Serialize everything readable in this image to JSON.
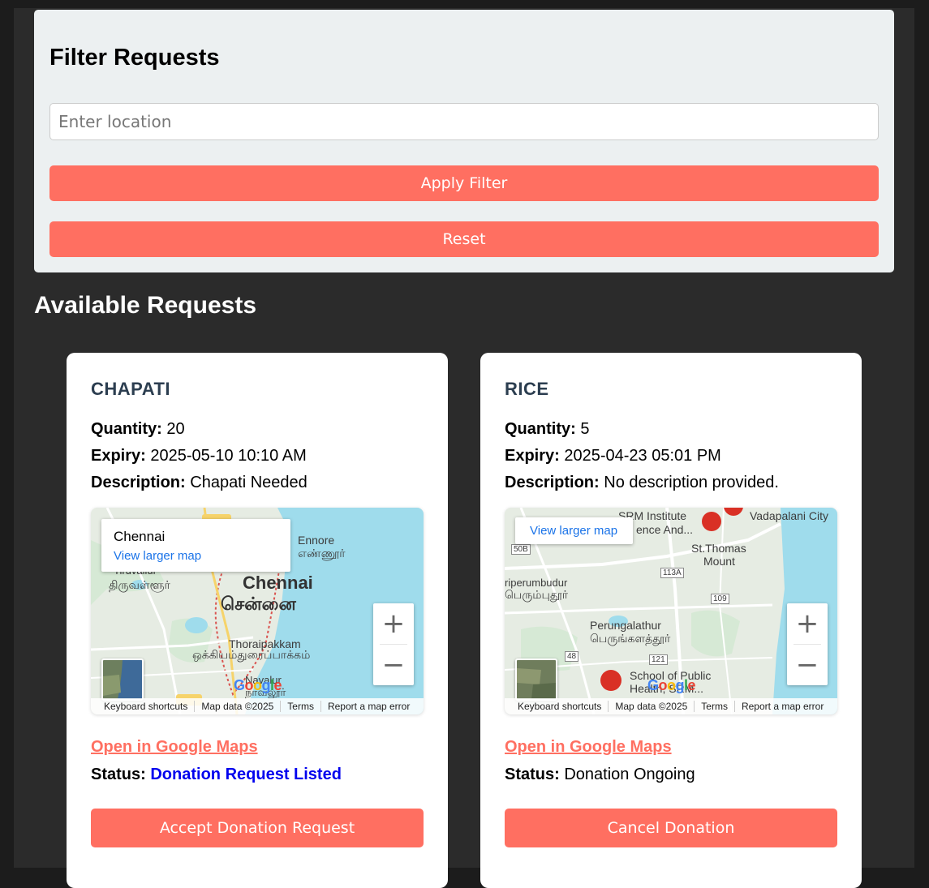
{
  "filter": {
    "title": "Filter Requests",
    "location_placeholder": "Enter location",
    "location_value": "",
    "apply_label": "Apply Filter",
    "reset_label": "Reset"
  },
  "requests_title": "Available Requests",
  "labels": {
    "quantity": "Quantity:",
    "expiry": "Expiry:",
    "description": "Description:",
    "status": "Status:",
    "open_maps": "Open in Google Maps"
  },
  "cards": [
    {
      "item": "CHAPATI",
      "quantity": "20",
      "expiry": "2025-05-10 10:10 AM",
      "description": "Chapati Needed",
      "status": "Donation Request Listed",
      "status_color": "#0000ee",
      "action_label": "Accept Donation Request",
      "map": {
        "info_place": "Chennai",
        "view_larger": "View larger map",
        "labels": [
          "Chennai",
          "சென்னை",
          "Thoraipakkam",
          "ஒக்கியம்துரைப்பாக்கம்",
          "Tiruvallur",
          "திருவள்ளூர்",
          "Ennore",
          "எண்ணூர்",
          "Navalur",
          "நாவலூர்"
        ],
        "zoom_in": "+",
        "zoom_out": "−",
        "attribution": [
          "Keyboard shortcuts",
          "Map data ©2025",
          "Terms",
          "Report a map error"
        ]
      }
    },
    {
      "item": "RICE",
      "quantity": "5",
      "expiry": "2025-04-23 05:01 PM",
      "description": "No description provided.",
      "status": "Donation Ongoing",
      "status_color": "#000000",
      "action_label": "Cancel Donation",
      "map": {
        "view_larger": "View larger map",
        "labels": [
          "SRM Institute",
          "ence And...",
          "Vadapalani City",
          "St.Thomas",
          "Mount",
          "riperumbudur",
          "பெரும்புதூர்",
          "Perungalathur",
          "பெருங்களத்தூர்",
          "School of Public",
          "Health, SRM...",
          "50B",
          "113A",
          "109",
          "48",
          "121"
        ],
        "zoom_in": "+",
        "zoom_out": "−",
        "attribution": [
          "Keyboard shortcuts",
          "Map data ©2025",
          "Terms",
          "Report a map error"
        ]
      }
    }
  ],
  "colors": {
    "accent": "#ff6f61",
    "filter_bg": "#ecf0f1",
    "page_bg": "#2b2b2b",
    "card_title": "#2c3e50",
    "link_blue": "#1a73e8"
  }
}
